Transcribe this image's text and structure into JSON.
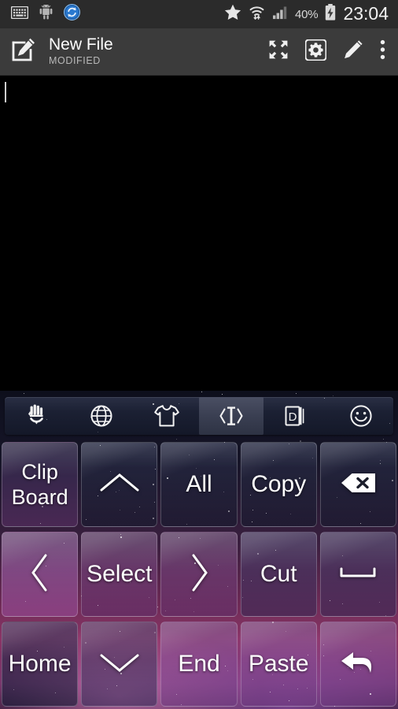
{
  "status_bar": {
    "left_icons": [
      {
        "name": "keyboard-icon",
        "label": "keyboard"
      },
      {
        "name": "android-icon",
        "label": "android"
      },
      {
        "name": "sync-icon",
        "label": "sync"
      }
    ],
    "right_icons": [
      {
        "name": "star-icon",
        "label": "star"
      },
      {
        "name": "wifi-icon",
        "label": "wifi"
      },
      {
        "name": "signal-icon",
        "label": "signal"
      }
    ],
    "battery_percent": "40%",
    "battery_state": "charging",
    "clock": "23:04"
  },
  "app_bar": {
    "icon": "compose-icon",
    "title": "New File",
    "subtitle": "MODIFIED",
    "actions": [
      {
        "name": "fullscreen-button",
        "label": "fullscreen"
      },
      {
        "name": "settings-button",
        "label": "settings"
      },
      {
        "name": "edit-button",
        "label": "edit"
      },
      {
        "name": "overflow-menu-button",
        "label": "more options"
      }
    ]
  },
  "editor": {
    "content": "",
    "caret_visible": true
  },
  "keyboard": {
    "toolbar": [
      {
        "name": "one-hand-icon",
        "label": "one-handed mode",
        "active": false
      },
      {
        "name": "globe-icon",
        "label": "language",
        "active": false
      },
      {
        "name": "tshirt-icon",
        "label": "theme",
        "active": false
      },
      {
        "name": "cursor-control-icon",
        "label": "cursor control",
        "active": true
      },
      {
        "name": "dictionary-icon",
        "label": "dictionary",
        "active": false
      },
      {
        "name": "emoji-icon",
        "label": "emoji",
        "active": false
      }
    ],
    "rows": [
      [
        {
          "name": "key-clipboard",
          "label": "Clip\nBoard",
          "type": "text",
          "mod": "k-clip"
        },
        {
          "name": "key-arrow-up",
          "label": "",
          "type": "chevron-up",
          "mod": "k-up"
        },
        {
          "name": "key-select-all",
          "label": "All",
          "type": "text",
          "mod": "k-all"
        },
        {
          "name": "key-copy",
          "label": "Copy",
          "type": "text",
          "mod": "k-copy"
        },
        {
          "name": "key-backspace",
          "label": "",
          "type": "backspace",
          "mod": "k-bksp"
        }
      ],
      [
        {
          "name": "key-arrow-left",
          "label": "",
          "type": "chevron-left",
          "mod": "k-left"
        },
        {
          "name": "key-select",
          "label": "Select",
          "type": "text",
          "mod": "k-select"
        },
        {
          "name": "key-arrow-right",
          "label": "",
          "type": "chevron-right",
          "mod": "k-right"
        },
        {
          "name": "key-cut",
          "label": "Cut",
          "type": "text",
          "mod": "k-cut"
        },
        {
          "name": "key-space",
          "label": "",
          "type": "space",
          "mod": "k-space"
        }
      ],
      [
        {
          "name": "key-home",
          "label": "Home",
          "type": "text",
          "mod": "k-home"
        },
        {
          "name": "key-arrow-down",
          "label": "",
          "type": "chevron-down",
          "mod": "k-down"
        },
        {
          "name": "key-end",
          "label": "End",
          "type": "text",
          "mod": "k-end"
        },
        {
          "name": "key-paste",
          "label": "Paste",
          "type": "text",
          "mod": "k-paste"
        },
        {
          "name": "key-enter",
          "label": "",
          "type": "enter",
          "mod": "k-enter"
        }
      ]
    ]
  },
  "colors": {
    "status_bar_bg": "#2b2b2b",
    "app_bar_bg": "#3b3b3b",
    "editor_bg": "#000000",
    "key_text": "#ffffff",
    "accent_nebula_pink": "#b8417f",
    "accent_nebula_purple": "#6b2a9e",
    "subtitle": "#b9b9b9"
  }
}
